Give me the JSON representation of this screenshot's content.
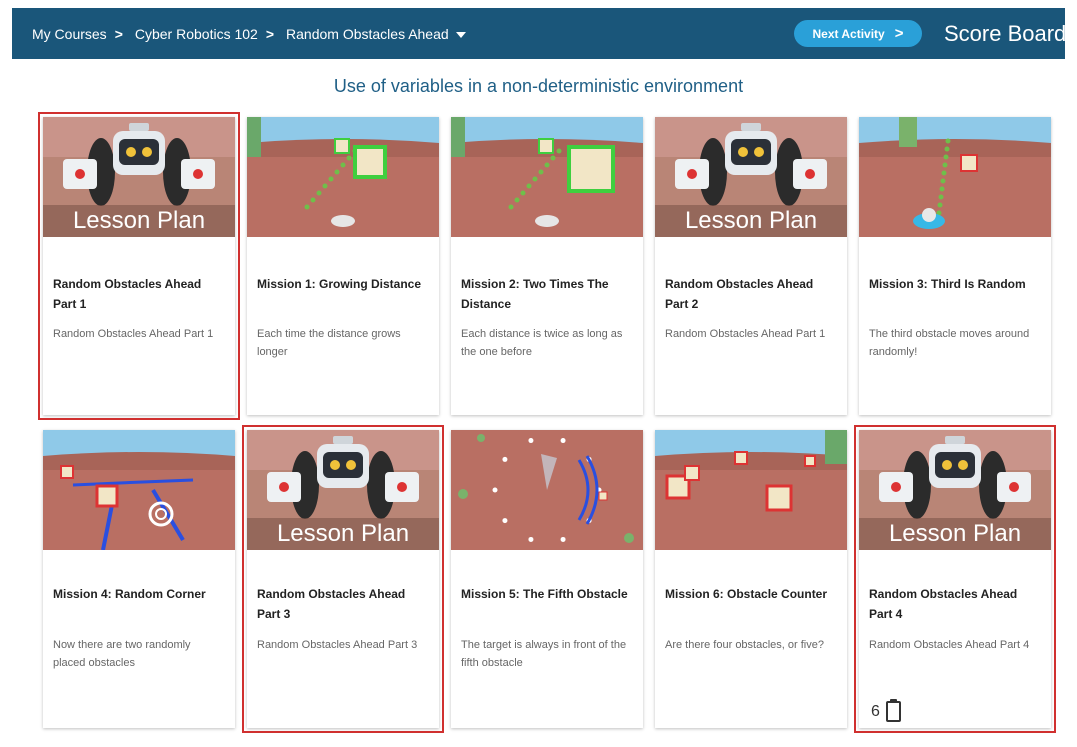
{
  "breadcrumb": {
    "items": [
      {
        "label": "My Courses"
      },
      {
        "label": "Cyber Robotics 102"
      },
      {
        "label": "Random Obstacles Ahead"
      }
    ]
  },
  "header": {
    "next_label": "Next Activity",
    "scoreboard_label": "Score Board"
  },
  "page": {
    "subtitle": "Use of variables in a non-deterministic environment"
  },
  "colors": {
    "topbar": "#1a567a",
    "accent_button": "#2aa0d8",
    "subtitle": "#1f5f86",
    "highlight_outline": "#d0302f"
  },
  "cards": [
    {
      "title": "Random Obstacles Ahead Part 1",
      "desc": "Random Obstacles Ahead Part 1",
      "thumb": "lesson",
      "thumb_label": "Lesson Plan",
      "outlined": true
    },
    {
      "title": "Mission 1: Growing Distance",
      "desc": "Each time the distance grows longer",
      "thumb": "scene-track"
    },
    {
      "title": "Mission 2: Two Times The Distance",
      "desc": "Each distance is twice as long as the one before",
      "thumb": "scene-track2"
    },
    {
      "title": "Random Obstacles Ahead Part 2",
      "desc": "Random Obstacles Ahead Part 1",
      "thumb": "lesson",
      "thumb_label": "Lesson Plan"
    },
    {
      "title": "Mission 3: Third Is Random",
      "desc": "The third obstacle moves around randomly!",
      "thumb": "scene-road"
    },
    {
      "title": "Mission 4: Random Corner",
      "desc": "Now there are two randomly placed obstacles",
      "thumb": "scene-corner"
    },
    {
      "title": "Random Obstacles Ahead Part 3",
      "desc": "Random Obstacles Ahead Part 3",
      "thumb": "lesson",
      "thumb_label": "Lesson Plan",
      "outlined": true
    },
    {
      "title": "Mission 5: The Fifth Obstacle",
      "desc": "The target is always in front of the fifth obstacle",
      "thumb": "scene-circle"
    },
    {
      "title": "Mission 6: Obstacle Counter",
      "desc": "Are there four obstacles, or five?",
      "thumb": "scene-counter"
    },
    {
      "title": "Random Obstacles Ahead Part 4",
      "desc": "Random Obstacles Ahead Part 4",
      "thumb": "lesson",
      "thumb_label": "Lesson Plan",
      "outlined": true,
      "count": "6",
      "count_icon": "clipboard-icon"
    }
  ]
}
